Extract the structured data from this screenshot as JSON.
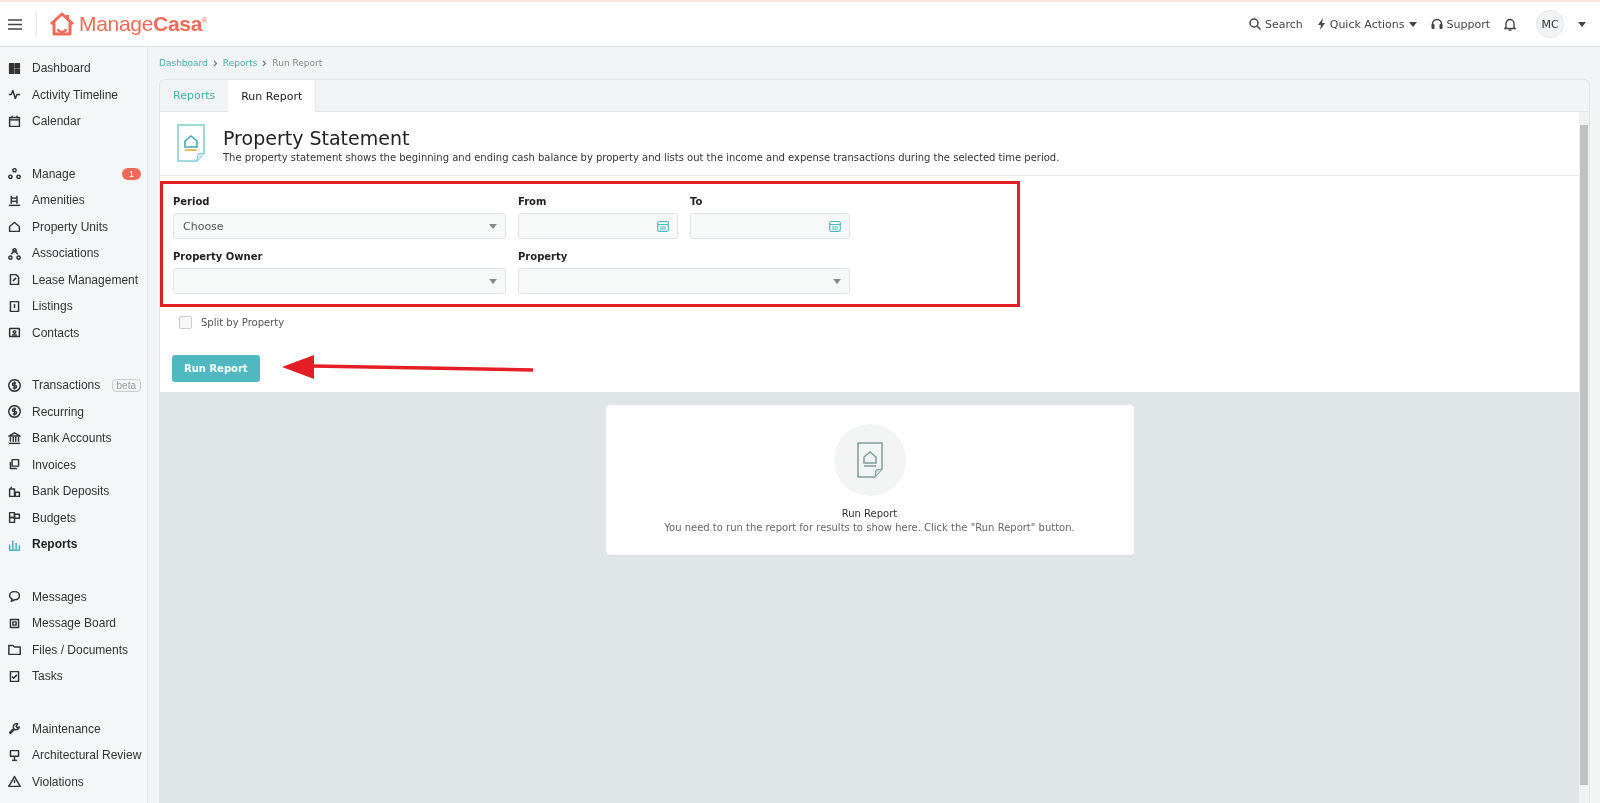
{
  "topbar": {
    "brand_light": "Manage",
    "brand_bold": "Casa",
    "brand_mark": "®",
    "actions": [
      {
        "label": "Search",
        "kind": "search"
      },
      {
        "label": "Quick Actions",
        "kind": "quick"
      },
      {
        "label": "Support",
        "kind": "support"
      }
    ],
    "avatar": "MC"
  },
  "sidebar": {
    "groups": [
      [
        {
          "label": "Dashboard",
          "selected": false
        },
        {
          "label": "Activity Timeline",
          "selected": false
        },
        {
          "label": "Calendar",
          "selected": false
        }
      ],
      [
        {
          "label": "Manage",
          "selected": false,
          "badge": "1"
        },
        {
          "label": "Amenities",
          "selected": false
        },
        {
          "label": "Property Units",
          "selected": false
        },
        {
          "label": "Associations",
          "selected": false
        },
        {
          "label": "Lease Management",
          "selected": false
        },
        {
          "label": "Listings",
          "selected": false
        },
        {
          "label": "Contacts",
          "selected": false
        }
      ],
      [
        {
          "label": "Transactions",
          "selected": false,
          "tag": "beta"
        },
        {
          "label": "Recurring",
          "selected": false
        },
        {
          "label": "Bank Accounts",
          "selected": false
        },
        {
          "label": "Invoices",
          "selected": false
        },
        {
          "label": "Bank Deposits",
          "selected": false
        },
        {
          "label": "Budgets",
          "selected": false
        },
        {
          "label": "Reports",
          "selected": true
        }
      ],
      [
        {
          "label": "Messages",
          "selected": false
        },
        {
          "label": "Message Board",
          "selected": false
        },
        {
          "label": "Files / Documents",
          "selected": false
        },
        {
          "label": "Tasks",
          "selected": false
        }
      ],
      [
        {
          "label": "Maintenance",
          "selected": false
        },
        {
          "label": "Architectural Review",
          "selected": false
        },
        {
          "label": "Violations",
          "selected": false
        }
      ]
    ]
  },
  "breadcrumb": [
    "Dashboard",
    "Reports",
    "Run Report"
  ],
  "tabs": [
    {
      "label": "Reports",
      "selected": false
    },
    {
      "label": "Run Report",
      "selected": true
    }
  ],
  "report": {
    "title": "Property Statement",
    "description": "The property statement shows the beginning and ending cash balance by property and lists out the income and expense transactions during the selected time period."
  },
  "form": {
    "highlighted": true,
    "rows": [
      [
        {
          "label": "Period",
          "kind": "select",
          "value": "Choose"
        },
        {
          "label": "From",
          "kind": "date"
        },
        {
          "label": "To",
          "kind": "date"
        }
      ],
      [
        {
          "label": "Property Owner",
          "kind": "select"
        },
        {
          "label": "Property",
          "kind": "select"
        }
      ]
    ]
  },
  "split_option": {
    "label": "Split by Property",
    "checked": false
  },
  "run_button": "Run Report",
  "pointer_arrow": true,
  "empty_state": {
    "title": "Run Report",
    "message": "You need to run the report for results to show here. Click the \"Run Report\" button."
  }
}
